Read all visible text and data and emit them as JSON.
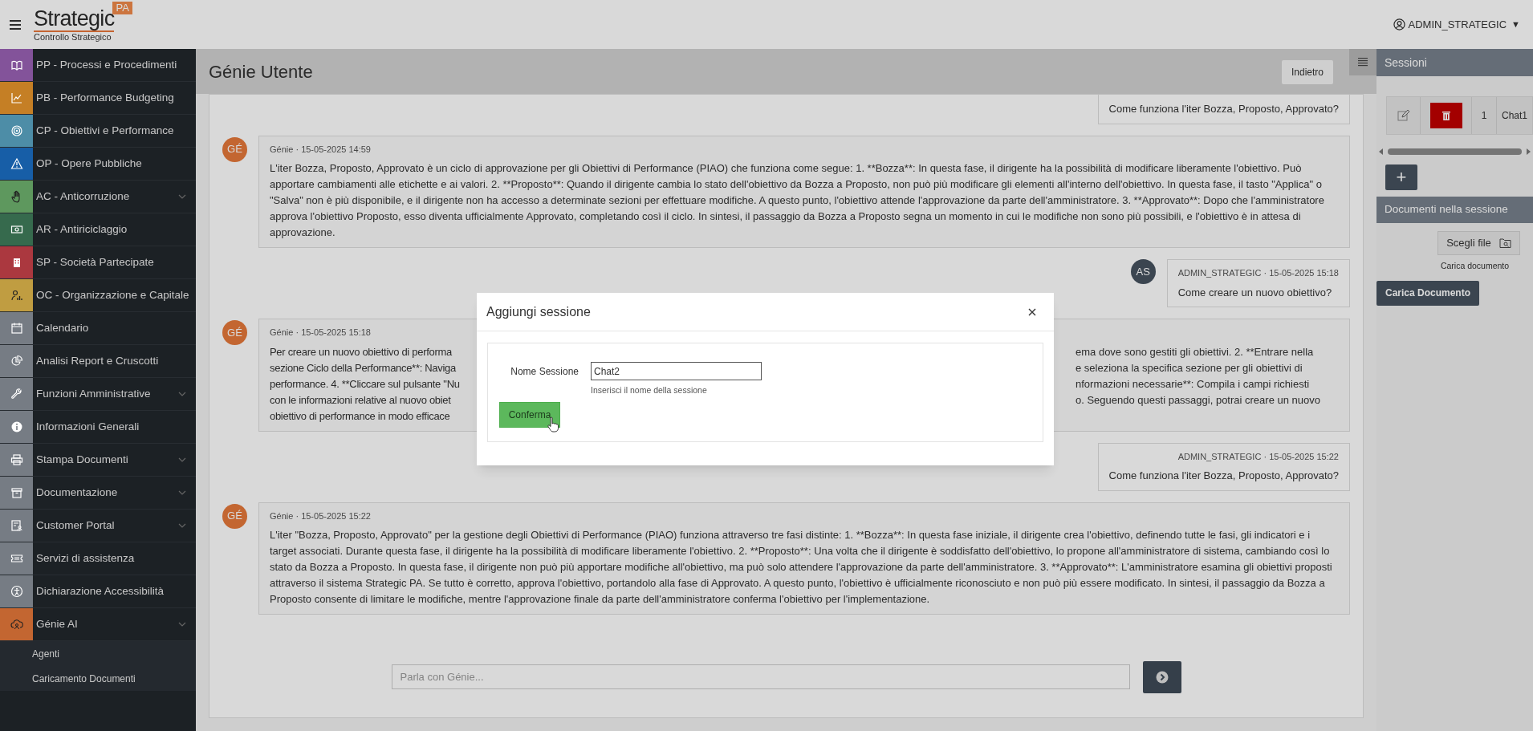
{
  "header": {
    "logo": {
      "name": "Strategic",
      "badge": "PA",
      "subtitle": "Controllo Strategico"
    },
    "user": "ADMIN_STRATEGIC",
    "user_caret": "▼"
  },
  "sidebar": {
    "items": [
      {
        "label": "PP - Processi e Procedimenti",
        "color": "#83539a",
        "expandable": false
      },
      {
        "label": "PB - Performance Budgeting",
        "color": "#c57f25",
        "expandable": false
      },
      {
        "label": "CP - Obiettivi e Performance",
        "color": "#4d8da7",
        "expandable": false
      },
      {
        "label": "OP - Opere Pubbliche",
        "color": "#175ea7",
        "expandable": false
      },
      {
        "label": "AC - Anticorruzione",
        "color": "#5e985e",
        "expandable": true
      },
      {
        "label": "AR - Antiriciclaggio",
        "color": "#366a4d",
        "expandable": false
      },
      {
        "label": "SP - Società Partecipate",
        "color": "#ab383f",
        "expandable": false
      },
      {
        "label": "OC - Organizzazione e Capitale",
        "color": "#c09d41",
        "expandable": false
      },
      {
        "label": "Calendario",
        "color": "#767c84",
        "expandable": false
      },
      {
        "label": "Analisi Report e Cruscotti",
        "color": "#767c84",
        "expandable": false
      },
      {
        "label": "Funzioni Amministrative",
        "color": "#767c84",
        "expandable": true
      },
      {
        "label": "Informazioni Generali",
        "color": "#767c84",
        "expandable": false
      },
      {
        "label": "Stampa Documenti",
        "color": "#767c84",
        "expandable": true
      },
      {
        "label": "Documentazione",
        "color": "#767c84",
        "expandable": true
      },
      {
        "label": "Customer Portal",
        "color": "#767c84",
        "expandable": true
      },
      {
        "label": "Servizi di assistenza",
        "color": "#767c84",
        "expandable": false
      },
      {
        "label": "Dichiarazione Accessibilità",
        "color": "#767c84",
        "expandable": false
      },
      {
        "label": "Génie AI",
        "color": "#c36631",
        "expandable": true,
        "children": [
          {
            "label": "Agenti"
          },
          {
            "label": "Caricamento Documenti"
          }
        ]
      }
    ]
  },
  "page": {
    "title": "Génie Utente",
    "back_button": "Indietro"
  },
  "chat": {
    "messages": [
      {
        "kind": "user",
        "text": "Come funziona l'iter Bozza, Proposto, Approvato?"
      },
      {
        "kind": "bot",
        "avatar": "GÉ",
        "meta": "Génie · 15-05-2025 14:59",
        "text": "L'iter Bozza, Proposto, Approvato è un ciclo di approvazione per gli Obiettivi di Performance (PIAO) che funziona come segue: 1. **Bozza**: In questa fase, il dirigente ha la possibilità di modificare liberamente l'obiettivo. Può apportare cambiamenti alle etichette e ai valori. 2. **Proposto**: Quando il dirigente cambia lo stato dell'obiettivo da Bozza a Proposto, non può più modificare gli elementi all'interno dell'obiettivo. In questa fase, il tasto \"Applica\" o \"Salva\" non è più disponibile, e il dirigente non ha accesso a determinate sezioni per effettuare modifiche. A questo punto, l'obiettivo attende l'approvazione da parte dell'amministratore. 3. **Approvato**: Dopo che l'amministratore approva l'obiettivo Proposto, esso diventa ufficialmente Approvato, completando così il ciclo. In sintesi, il passaggio da Bozza a Proposto segna un momento in cui le modifiche non sono più possibili, e l'obiettivo è in attesa di approvazione."
      },
      {
        "kind": "user",
        "avatar": "AS",
        "meta": "ADMIN_STRATEGIC · 15-05-2025 15:18",
        "text": "Come creare un nuovo obiettivo?"
      },
      {
        "kind": "bot_partial",
        "avatar": "GÉ",
        "meta": "Génie · 15-05-2025 15:18",
        "lines": [
          {
            "left": "Per creare un nuovo obiettivo di performa",
            "right": "ema dove sono gestiti gli obiettivi. 2. **Entrare nella"
          },
          {
            "left": "sezione Ciclo della Performance**: Naviga",
            "right": "e seleziona la specifica sezione per gli obiettivi di"
          },
          {
            "left": "performance. 4. **Cliccare sul pulsante \"Nu",
            "right": "nformazioni necessarie**: Compila i campi richiesti"
          },
          {
            "left": "con le informazioni relative al nuovo obiet",
            "right": "o. Seguendo questi passaggi, potrai creare un nuovo"
          },
          {
            "left": "obiettivo di performance in modo efficace"
          }
        ]
      },
      {
        "kind": "user",
        "meta": "ADMIN_STRATEGIC · 15-05-2025 15:22",
        "text": "Come funziona l'iter Bozza, Proposto, Approvato?"
      },
      {
        "kind": "bot",
        "avatar": "GÉ",
        "meta": "Génie · 15-05-2025 15:22",
        "text": "L'iter \"Bozza, Proposto, Approvato\" per la gestione degli Obiettivi di Performance (PIAO) funziona attraverso tre fasi distinte: 1. **Bozza**: In questa fase iniziale, il dirigente crea l'obiettivo, definendo tutte le fasi, gli indicatori e i target associati. Durante questa fase, il dirigente ha la possibilità di modificare liberamente l'obiettivo. 2. **Proposto**: Una volta che il dirigente è soddisfatto dell'obiettivo, lo propone all'amministratore di sistema, cambiando così lo stato da Bozza a Proposto. In questa fase, il dirigente non può più apportare modifiche all'obiettivo, ma può solo attendere l'approvazione da parte dell'amministratore. 3. **Approvato**: L'amministratore esamina gli obiettivi proposti attraverso il sistema Strategic PA. Se tutto è corretto, approva l'obiettivo, portandolo alla fase di Approvato. A questo punto, l'obiettivo è ufficialmente riconosciuto e non può più essere modificato. In sintesi, il passaggio da Bozza a Proposto consente di limitare le modifiche, mentre l'approvazione finale da parte dell'amministratore conferma l'obiettivo per l'implementazione."
      }
    ],
    "composer": {
      "placeholder": "Parla con Génie..."
    }
  },
  "right_panel": {
    "sessions": {
      "title": "Sessioni",
      "rows": [
        {
          "number": "1",
          "name": "Chat1"
        }
      ],
      "add_button": "+"
    },
    "documents": {
      "title": "Documenti nella sessione",
      "file_button": "Scegli file",
      "hint": "Carica documento",
      "upload_button": "Carica Documento"
    }
  },
  "modal": {
    "title": "Aggiungi sessione",
    "field": {
      "label": "Nome Sessione",
      "value": "Chat2",
      "help": "Inserisci il nome della sessione"
    },
    "confirm_button": "Conferma"
  }
}
